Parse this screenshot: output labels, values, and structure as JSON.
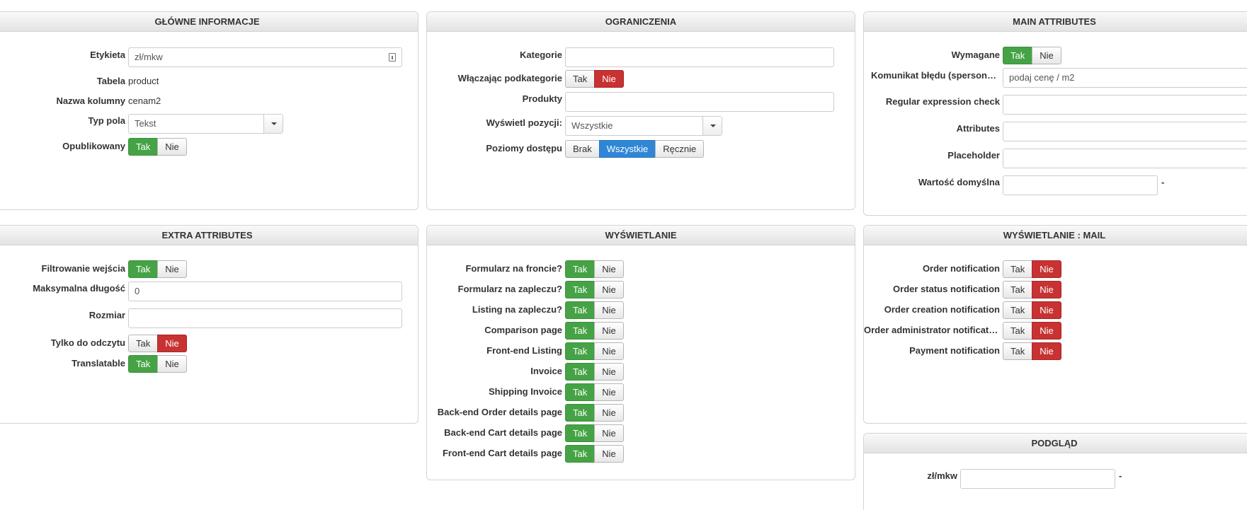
{
  "glowne": {
    "title": "GŁÓWNE INFORMACJE",
    "etykieta_label": "Etykieta",
    "etykieta_value": "zł/mkw",
    "tabela_label": "Tabela",
    "tabela_value": "product",
    "kolumna_label": "Nazwa kolumny",
    "kolumna_value": "cenam2",
    "typ_label": "Typ pola",
    "typ_value": "Tekst",
    "opublikowany_label": "Opublikowany"
  },
  "ograniczenia": {
    "title": "OGRANICZENIA",
    "kategorie_label": "Kategorie",
    "podkategorie_label": "Włączając podkategorie",
    "produkty_label": "Produkty",
    "pozycji_label": "Wyświetl pozycji:",
    "pozycji_value": "Wszystkie",
    "poziomy_label": "Poziomy dostępu",
    "poziomy_options": [
      "Brak",
      "Wszystkie",
      "Ręcznie"
    ]
  },
  "main_attr": {
    "title": "MAIN ATTRIBUTES",
    "wymagane_label": "Wymagane",
    "komunikat_label": "Komunikat błędu (spersonalizowany)",
    "komunikat_value": "podaj cenę / m2",
    "regex_label": "Regular expression check",
    "attributes_label": "Attributes",
    "placeholder_label": "Placeholder",
    "domyslna_label": "Wartość domyślna",
    "dash": "-"
  },
  "extra": {
    "title": "EXTRA ATTRIBUTES",
    "filtrowanie_label": "Filtrowanie wejścia",
    "dlugosc_label": "Maksymalna długość",
    "dlugosc_value": "0",
    "rozmiar_label": "Rozmiar",
    "odczyt_label": "Tylko do odczytu",
    "translatable_label": "Translatable"
  },
  "wyswietlanie": {
    "title": "WYŚWIETLANIE",
    "items": [
      "Formularz na froncie?",
      "Formularz na zapleczu?",
      "Listing na zapleczu?",
      "Comparison page",
      "Front-end Listing",
      "Invoice",
      "Shipping Invoice",
      "Back-end Order details page",
      "Back-end Cart details page",
      "Front-end Cart details page"
    ]
  },
  "mail": {
    "title": "WYŚWIETLANIE : MAIL",
    "items": [
      "Order notification",
      "Order status notification",
      "Order creation notification",
      "Order administrator notification",
      "Payment notification"
    ]
  },
  "podglad": {
    "title": "PODGLĄD",
    "label": "zł/mkw",
    "dash": "-"
  },
  "common": {
    "tak": "Tak",
    "nie": "Nie"
  },
  "colors": {
    "green": "#45a345",
    "red": "#c83232",
    "blue": "#2f86d6"
  }
}
